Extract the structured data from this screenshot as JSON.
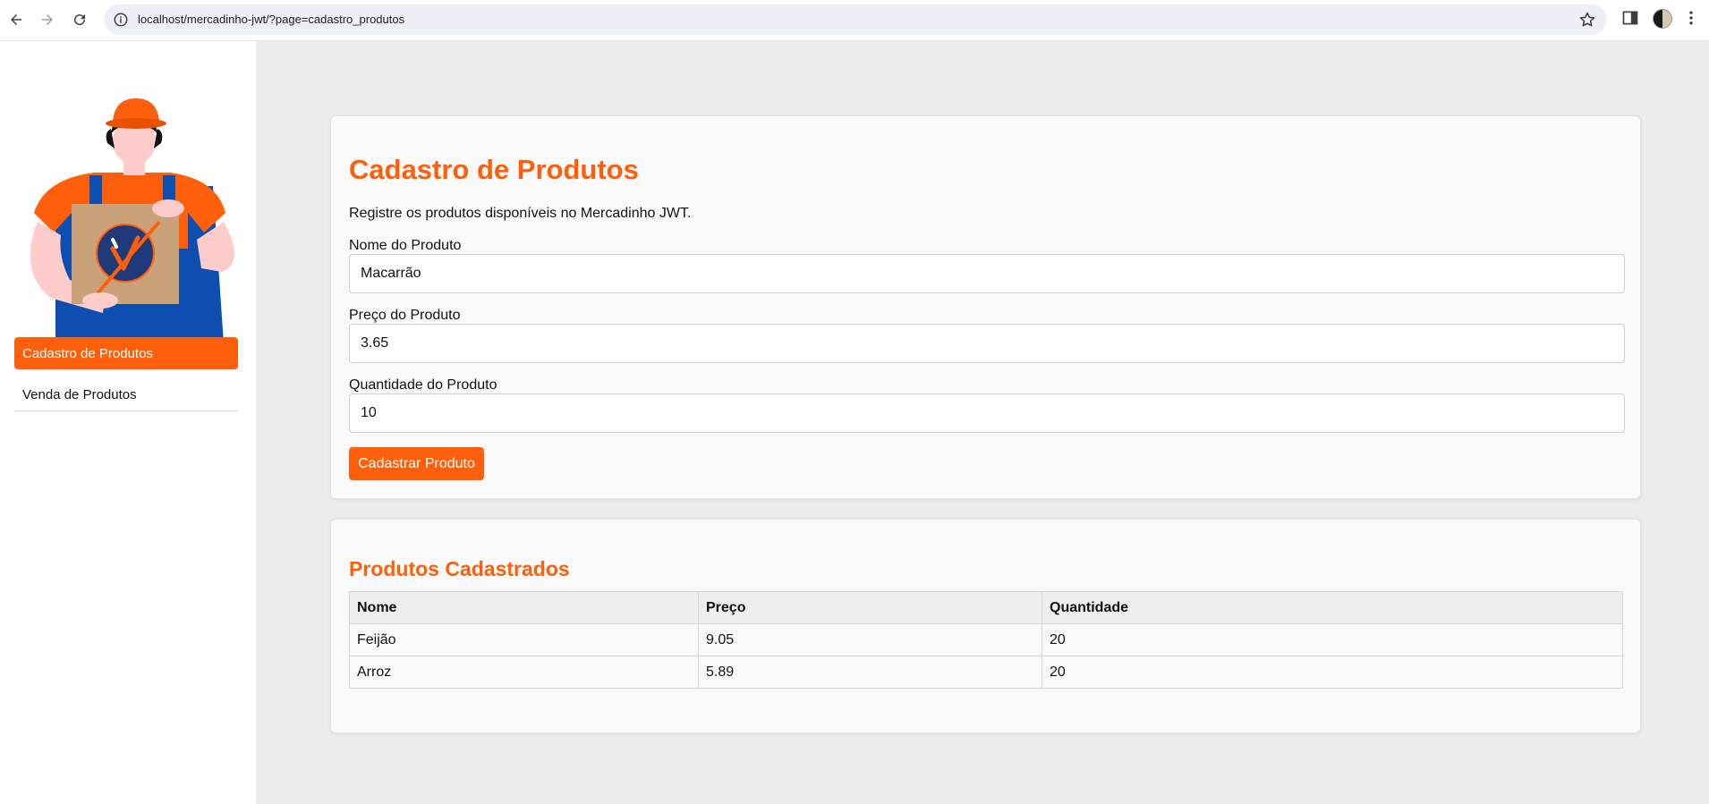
{
  "browser": {
    "url": "localhost/mercadinho-jwt/?page=cadastro_produtos",
    "icons": [
      "back-arrow-icon",
      "forward-arrow-icon",
      "reload-icon",
      "site-info-icon",
      "bookmark-star-icon",
      "side-panel-icon",
      "profile-avatar",
      "kebab-menu-icon"
    ]
  },
  "colors": {
    "accent": "#ff5f0a",
    "page_bg": "#ececec",
    "card_bg": "#fafafa"
  },
  "sidebar": {
    "items": [
      {
        "label": "Cadastro de Produtos",
        "active": true
      },
      {
        "label": "Venda de Produtos",
        "active": false
      }
    ]
  },
  "form": {
    "title": "Cadastro de Produtos",
    "description": "Registre os produtos disponíveis no Mercadinho JWT.",
    "name_label": "Nome do Produto",
    "name_value": "Macarrão",
    "price_label": "Preço do Produto",
    "price_value": "3.65",
    "qty_label": "Quantidade do Produto",
    "qty_value": "10",
    "submit_label": "Cadastrar Produto"
  },
  "products": {
    "title": "Produtos Cadastrados",
    "headers": [
      "Nome",
      "Preço",
      "Quantidade"
    ],
    "rows": [
      [
        "Feijão",
        "9.05",
        "20"
      ],
      [
        "Arroz",
        "5.89",
        "20"
      ]
    ]
  }
}
